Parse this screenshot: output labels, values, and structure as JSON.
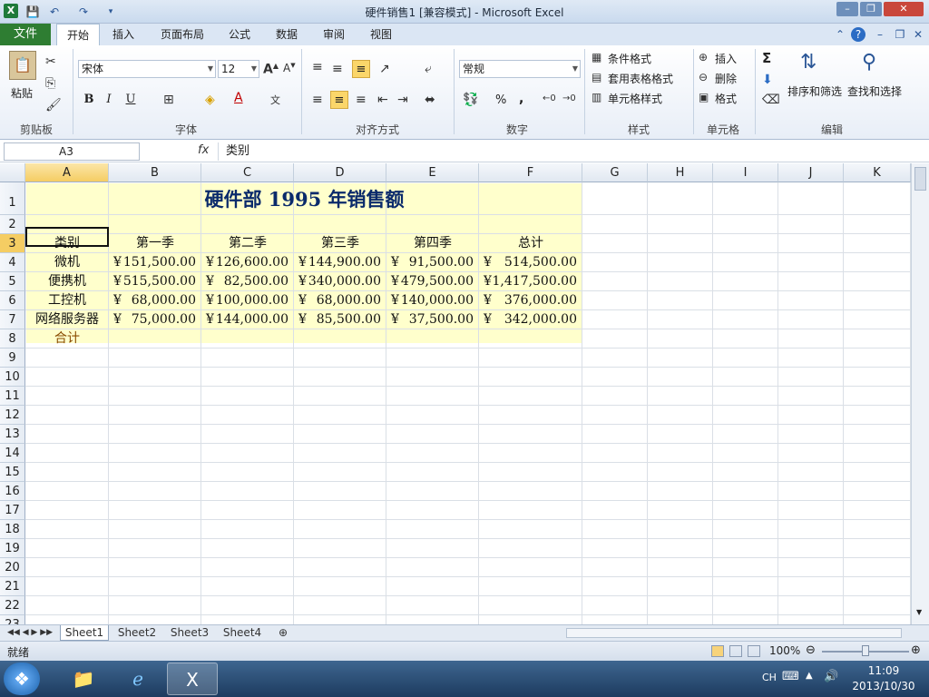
{
  "window": {
    "title": "硬件销售1  [兼容模式] - Microsoft Excel"
  },
  "tabs": [
    {
      "label": "文件"
    },
    {
      "label": "开始"
    },
    {
      "label": "插入"
    },
    {
      "label": "页面布局"
    },
    {
      "label": "公式"
    },
    {
      "label": "数据"
    },
    {
      "label": "审阅"
    },
    {
      "label": "视图"
    }
  ],
  "ribbon": {
    "clipboard": {
      "paste": "粘贴",
      "group": "剪贴板"
    },
    "font": {
      "name": "宋体",
      "size": "12",
      "group": "字体",
      "bold": "B",
      "italic": "I",
      "underline": "U"
    },
    "align": {
      "group": "对齐方式"
    },
    "number": {
      "format": "常规",
      "group": "数字",
      "percent": "%",
      "comma": ","
    },
    "styles": {
      "cond": "条件格式",
      "table": "套用表格格式",
      "cell": "单元格样式",
      "group": "样式"
    },
    "cells": {
      "insert": "插入",
      "delete": "删除",
      "format": "格式",
      "group": "单元格"
    },
    "editing": {
      "sort": "排序和筛选",
      "find": "查找和选择",
      "group": "编辑",
      "sum": "Σ"
    }
  },
  "formula_bar": {
    "name_box": "A3",
    "fx": "fx",
    "content": "类别"
  },
  "columns": [
    "A",
    "B",
    "C",
    "D",
    "E",
    "F",
    "G",
    "H",
    "I",
    "J",
    "K"
  ],
  "rows": [
    "1",
    "2",
    "3",
    "4",
    "5",
    "6",
    "7",
    "8",
    "9",
    "10",
    "11",
    "12",
    "13",
    "14",
    "15",
    "16",
    "17",
    "18",
    "19",
    "20",
    "21",
    "22",
    "23"
  ],
  "sheet": {
    "title": "硬件部 1995 年销售额",
    "headers": [
      "类别",
      "第一季",
      "第二季",
      "第三季",
      "第四季",
      "总计"
    ],
    "currency": "¥",
    "data": [
      {
        "cat": "微机",
        "q1": "151,500.00",
        "q2": "126,600.00",
        "q3": "144,900.00",
        "q4": "91,500.00",
        "total": "514,500.00"
      },
      {
        "cat": "便携机",
        "q1": "515,500.00",
        "q2": "82,500.00",
        "q3": "340,000.00",
        "q4": "479,500.00",
        "total": "1,417,500.00"
      },
      {
        "cat": "工控机",
        "q1": "68,000.00",
        "q2": "100,000.00",
        "q3": "68,000.00",
        "q4": "140,000.00",
        "total": "376,000.00"
      },
      {
        "cat": "网络服务器",
        "q1": "75,000.00",
        "q2": "144,000.00",
        "q3": "85,500.00",
        "q4": "37,500.00",
        "total": "342,000.00"
      }
    ],
    "sum_label": "合计"
  },
  "sheet_tabs": [
    "Sheet1",
    "Sheet2",
    "Sheet3",
    "Sheet4"
  ],
  "status": {
    "text": "就绪",
    "zoom": "100%"
  },
  "taskbar": {
    "time": "11:09",
    "date": "2013/10/30",
    "lang": "CH"
  }
}
